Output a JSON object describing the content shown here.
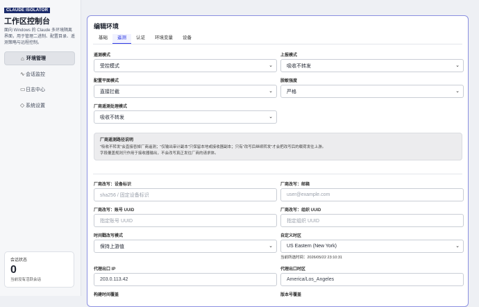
{
  "sidebar": {
    "brand": "CLAUDE ISOLATOR",
    "title": "工作区控制台",
    "description": "面向 Windows 的 Claude 多环境隔离界面，用于管理二进制、配置目录、遥测策略与远程控制。",
    "items": [
      {
        "label": "环境管理",
        "icon": "home-icon",
        "active": true
      },
      {
        "label": "会话监控",
        "icon": "pulse-icon",
        "active": false
      },
      {
        "label": "日志中心",
        "icon": "document-icon",
        "active": false
      },
      {
        "label": "系统设置",
        "icon": "gear-icon",
        "active": false
      }
    ],
    "status": {
      "title": "会话状态",
      "count": "0",
      "subtitle": "当前没有活跃会话"
    }
  },
  "panel": {
    "title": "编辑环境",
    "tabs": [
      {
        "label": "基础",
        "active": false
      },
      {
        "label": "遥测",
        "active": true
      },
      {
        "label": "认证",
        "active": false
      },
      {
        "label": "环境变量",
        "active": false
      },
      {
        "label": "设备",
        "active": false
      }
    ],
    "fields": {
      "telemetry_mode": {
        "label": "遥测模式",
        "value": "受控模式"
      },
      "upload_mode": {
        "label": "上报模式",
        "value": "吸收不转发"
      },
      "config_plane": {
        "label": "配置平面模式",
        "value": "直接拦截"
      },
      "desensitize": {
        "label": "脱敏强度",
        "value": "严格"
      },
      "vendor_telemetry": {
        "label": "厂商遥测处理模式",
        "value": "吸收不转发"
      }
    },
    "info": {
      "title": "厂商遥测路径说明",
      "line1": "\"吸收不转发\"会直接吞掉厂商遥测；\"仅输出审计副本\"只保留本地或接收器副本；只有\"改写后继续转发\"才会把改写后的载荷发往上游。",
      "line2": "字段覆盖规则只作用于接收器输出，不会改写真正发往厂商的请求体。"
    },
    "overrides": {
      "device_id": {
        "label": "厂商改写：设备标识",
        "placeholder": "sha256 / 固定设备标识"
      },
      "email": {
        "label": "厂商改写：邮箱",
        "placeholder": "user@example.com"
      },
      "account_uuid": {
        "label": "厂商改写：账号 UUID",
        "placeholder": "指定账号 UUID"
      },
      "org_uuid": {
        "label": "厂商改写：组织 UUID",
        "placeholder": "指定组织 UUID"
      },
      "time_mode": {
        "label": "时间戳改写模式",
        "value": "保持上游值"
      },
      "timezone": {
        "label": "自定义时区",
        "value": "US Eastern (New York)"
      },
      "current_time": "当前所选时间：2026/05/22 23:10:31",
      "egress_ip": {
        "label": "代理出口 IP",
        "value": "203.0.113.42"
      },
      "egress_tz": {
        "label": "代理出口时区",
        "value": "America/Los_Angeles"
      },
      "build_time": {
        "label": "构建时间覆盖"
      },
      "version": {
        "label": "版本号覆盖"
      }
    }
  }
}
